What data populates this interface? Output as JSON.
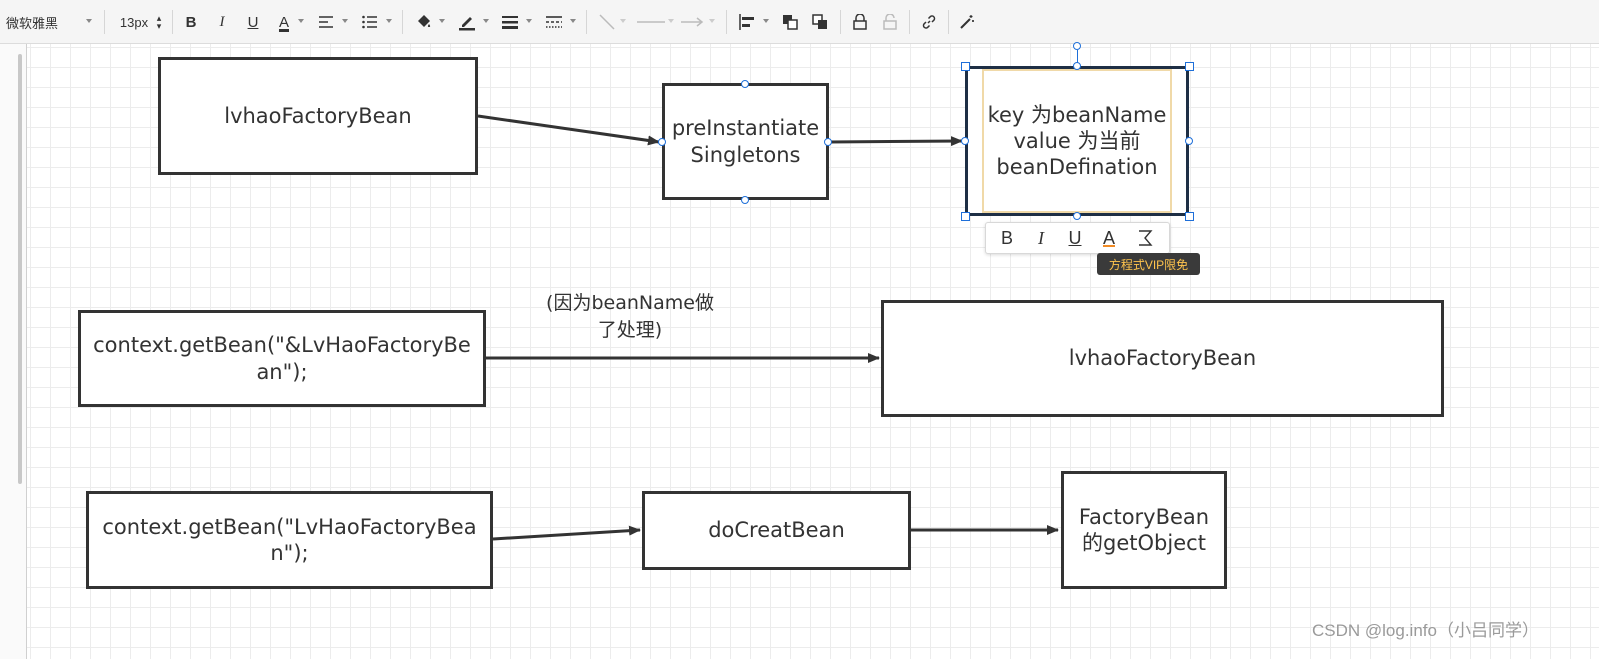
{
  "toolbar": {
    "font_family": "微软雅黑",
    "font_size": "13px",
    "bold": "B",
    "italic": "I",
    "underline": "U",
    "font_color": "A"
  },
  "diagram": {
    "box_factorybean_top": "lvhaoFactoryBean",
    "box_preinstantiate": "preInstantiateSingletons",
    "box_key_line1": "key 为beanName",
    "box_key_line2": "value 为当前",
    "box_key_line3": "beanDefination",
    "box_getbean_amp": "context.getBean(\"&LvHaoFactoryBean\");",
    "label_note_line1": "(因为beanName做",
    "label_note_line2": "了处理)",
    "box_factorybean_mid": "lvhaoFactoryBean",
    "box_getbean_plain": "context.getBean(\"LvHaoFactoryBean\");",
    "box_docreatbean": "doCreatBean",
    "box_getobject_line1": "FactoryBean",
    "box_getobject_line2": "的getObject"
  },
  "text_toolbar": {
    "bold": "B",
    "italic": "I",
    "underline": "U",
    "font_color": "A",
    "vip_badge": "方程式VIP限免"
  },
  "watermark": "CSDN @log.info（小吕同学）"
}
